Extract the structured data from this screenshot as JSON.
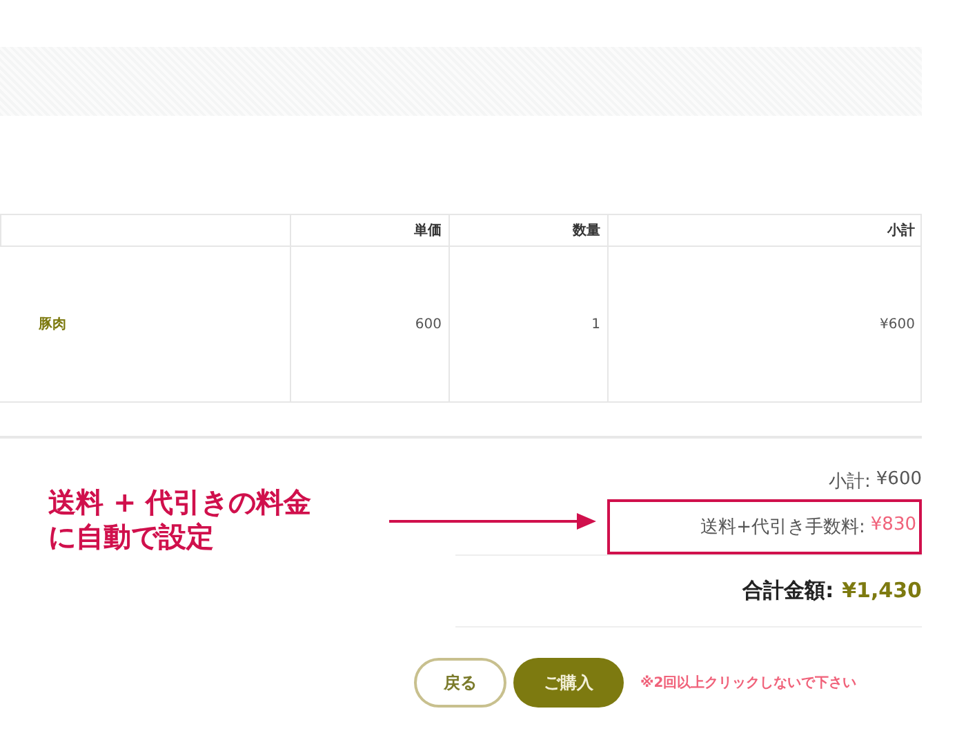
{
  "table": {
    "columns": [
      "単価",
      "数量",
      "小計"
    ],
    "rows": [
      {
        "item": "豚肉",
        "unit_price": "600",
        "quantity": "1",
        "subtotal": "¥600"
      }
    ]
  },
  "summary": {
    "subtotal": {
      "label": "小計:",
      "value": "¥600"
    },
    "fee": {
      "label": "送料+代引き手数料:",
      "value": "¥830"
    },
    "total": {
      "label": "合計金額:",
      "value": "¥1,430"
    }
  },
  "buttons": {
    "back": "戻る",
    "purchase": "ご購入",
    "note": "※2回以上クリックしないで下さい"
  },
  "annotation": {
    "lines": [
      "送料 + 代引きの料金",
      "に自動で設定"
    ]
  }
}
